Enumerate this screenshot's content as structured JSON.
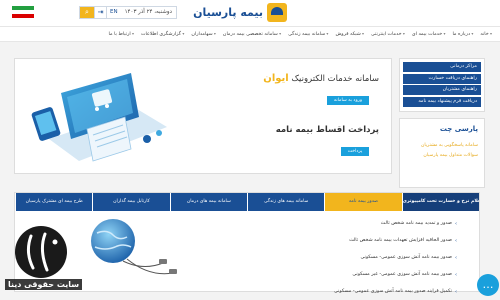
{
  "header": {
    "brand_name": "بیمه پارسیان",
    "date": "دوشنبه، ۲۴ آذر ۱۴۰۳",
    "lang": "EN",
    "login_icon": "login-icon",
    "search_icon": "search-icon"
  },
  "nav": {
    "items": [
      "خانه",
      "درباره ما",
      "خدمات بیمه ای",
      "خدمات اینترنتی",
      "شبکه فروش",
      "سامانه بیمه زندگی",
      "سامانه تخصصی بیمه درمان",
      "سهامداران",
      "گزارشگری اطلاعات",
      "ارتباط با ما"
    ]
  },
  "sidebar": {
    "quick_links": [
      "مراکز درمانی",
      "راهنمای دریافت خسارت",
      "راهنمای مشتریان",
      "دریافت فرم پیشنهاد بیمه نامه"
    ],
    "chat_title": "پارسی چت",
    "chat_links": [
      "سامانه پاسخگویی به مشتریان",
      "سوالات متداول بیمه پارسیان"
    ]
  },
  "banner": {
    "title_prefix": "سامانه خدمات الکترونیک",
    "title_highlight": "ایوان",
    "btn_enter": "ورود به سامانه",
    "subtitle": "پرداخت اقساط بیمه نامه",
    "btn_pay": "پرداخت"
  },
  "services": {
    "tabs": [
      "استعلام نرخ و خسارت تحت کامپیوتری",
      "صدور بیمه نامه",
      "سامانه بیمه های زندگی",
      "سامانه بیمه های درمان",
      "کارتابل بیمه گذاران",
      "طرح بیمه ای مشترک پارسیان"
    ],
    "items": [
      "صدور و تمدید بیمه نامه شخص ثالث",
      "صدور الحاقیه افزایش تعهدات بیمه نامه شخص ثالث",
      "صدور بیمه نامه آتش سوزی عمومی- مسکونی",
      "صدور بیمه نامه آتش سوزی عمومی- غیر مسکونی",
      "تکمیل فرایند صدور بیمه نامه آتش سوزی عمومی- مسکونی"
    ]
  },
  "watermark": {
    "text": "سایت حقوقی دینا"
  },
  "colors": {
    "primary": "#1a4f95",
    "accent": "#f2b51d",
    "button": "#1aa0dc"
  }
}
